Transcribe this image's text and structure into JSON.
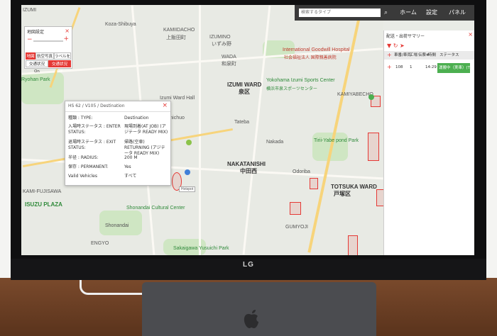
{
  "topbar": {
    "search_placeholder": "検索するタイプ",
    "nav": [
      "ホーム",
      "設定",
      "パネル"
    ]
  },
  "map_settings": {
    "title": "地図設定",
    "buttons_row1": [
      "地図",
      "航空写真",
      "ラベルを"
    ],
    "buttons_row2": [
      "交通状況 On",
      "交通状況 Off"
    ]
  },
  "map_labels": {
    "kamiidacho": "KAMIIDACHO",
    "kamiidacho_jp": "上飯田町",
    "izumino": "IZUMINO",
    "izumino_jp": "いずみ野",
    "wada": "WADA",
    "wada_jp": "和泉町",
    "hospital": "International Goodwill Hospital",
    "hospital_jp": "社会福祉法人 国際親善病院",
    "izumi_ward": "IZUMI WARD",
    "izumi_ward_jp": "泉区",
    "yokohama_sports": "Yokohama Izumi Sports Center",
    "yokohama_sports_jp": "横浜市泉スポーツセンター",
    "izumi_ward_hall": "Izumi Ward Hall",
    "izumi_chuo": "Izumichuo",
    "ryohan_park": "Ryohan Park",
    "tateba": "Tateba",
    "nakada": "Nakada",
    "nakatanishi": "NAKATANISHI",
    "nakatanishi_jp": "中田西",
    "odoriba": "Odoriba",
    "tirii_park": "Tirii-Yabe pond Park",
    "totsuka_ward": "TOTSUKA WARD",
    "totsuka_ward_jp": "戸塚区",
    "kamiyabecho": "KAMIYABECHO",
    "isuzu_plaza": "ISUZU PLAZA",
    "shonandai_center": "Shonandai Cultural Center",
    "shonandai": "Shonandai",
    "engyo": "ENGYO",
    "sakaigawa": "Sakaigawa Yusuichi Park",
    "gumyoji": "GUMYOJI",
    "kamifujisawa": "KAMI-FUJISAWA",
    "kozawa_shisho": "Koza-Shibuya",
    "izumi_gakuen": "IZUMI",
    "hotspot": "Hotspot"
  },
  "popup": {
    "title": "HS 62 / V105 / Destination",
    "rows": [
      {
        "label": "種類 : TYPE:",
        "value": "Destination"
      },
      {
        "label": "入場時ステータス : ENTER STATUS:",
        "value": "現場到着(AT JOB) (アジテータ READY MIX)"
      },
      {
        "label": "退場時ステータス : EXIT STATUS:",
        "value": "帰路(空車) RETURNING (アジテータ READY MIX)"
      },
      {
        "label": "半径 : RADIUS:",
        "value": "200 M"
      },
      {
        "label": "保存 : PERMANENT:",
        "value": "Yes"
      },
      {
        "label": "Valid Vehicles",
        "value": "すべて"
      }
    ]
  },
  "summary": {
    "title": "配送・出荷サマリー",
    "headers": [
      "",
      "車番/車両",
      "工場",
      "伝票#",
      "時間",
      "ステータス"
    ],
    "row": {
      "vehicle": "108",
      "plant": "1",
      "time": "14:29",
      "status": "運搬中（実車）(TO JOB"
    },
    "status_color": "#4caf50"
  },
  "device": {
    "brand": "LG"
  }
}
